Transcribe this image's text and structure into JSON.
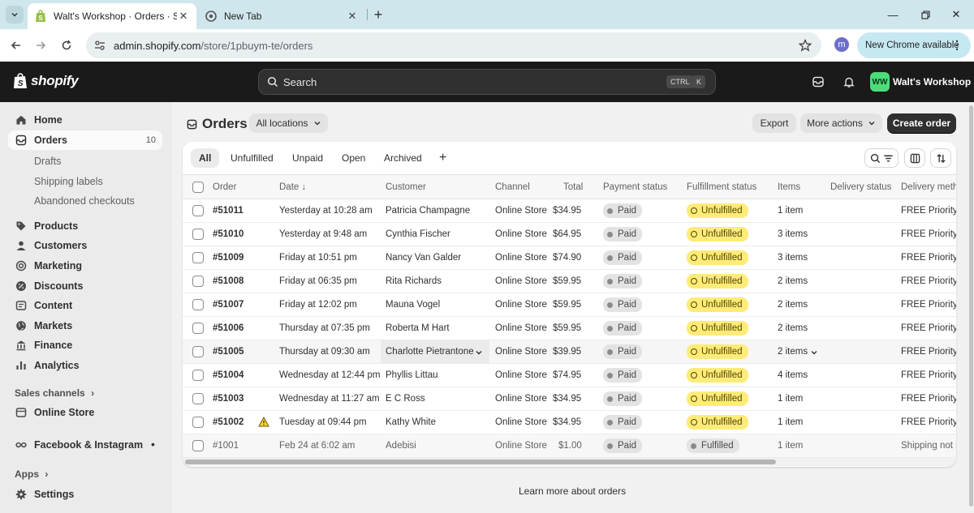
{
  "browser": {
    "tabs": [
      {
        "title": "Walt's Workshop · Orders · Shopify",
        "active": true
      },
      {
        "title": "New Tab",
        "active": false
      }
    ],
    "url_host": "admin.shopify.com",
    "url_path": "/store/1pbuym-te/orders",
    "profile_initial": "m",
    "update_label": "New Chrome available"
  },
  "topbar": {
    "logo_text": "shopify",
    "search_placeholder": "Search",
    "shortcut_ctrl": "CTRL",
    "shortcut_key": "K",
    "store_initials": "WW",
    "store_name": "Walt's Workshop",
    "colors": {
      "store_badge": "#4ddc7a"
    }
  },
  "sidebar": {
    "home": "Home",
    "orders": "Orders",
    "orders_count": "10",
    "orders_sub": [
      "Drafts",
      "Shipping labels",
      "Abandoned checkouts"
    ],
    "items": [
      "Products",
      "Customers",
      "Marketing",
      "Discounts",
      "Content",
      "Markets",
      "Finance",
      "Analytics"
    ],
    "sales_channels_label": "Sales channels",
    "online_store": "Online Store",
    "facebook": "Facebook & Instagram",
    "apps_label": "Apps",
    "settings": "Settings"
  },
  "page": {
    "title": "Orders",
    "location_select": "All locations",
    "export_label": "Export",
    "more_actions_label": "More actions",
    "create_order_label": "Create order",
    "learn_more": "Learn more about orders"
  },
  "filters": [
    "All",
    "Unfulfilled",
    "Unpaid",
    "Open",
    "Archived"
  ],
  "table": {
    "columns": [
      "Order",
      "Date",
      "Customer",
      "Channel",
      "Total",
      "Payment status",
      "Fulfillment status",
      "Items",
      "Delivery status",
      "Delivery method"
    ],
    "date_sort_arrow": "↓",
    "rows": [
      {
        "order": "#51011",
        "date": "Yesterday at 10:28 am",
        "customer": "Patricia Champagne",
        "channel": "Online Store",
        "total": "$34.95",
        "payment": "Paid",
        "fulfillment": "Unfulfilled",
        "items": "1 item",
        "delivery_method": "FREE Priority Ship"
      },
      {
        "order": "#51010",
        "date": "Yesterday at 9:48 am",
        "customer": "Cynthia Fischer",
        "channel": "Online Store",
        "total": "$64.95",
        "payment": "Paid",
        "fulfillment": "Unfulfilled",
        "items": "3 items",
        "delivery_method": "FREE Priority Ship"
      },
      {
        "order": "#51009",
        "date": "Friday at 10:51 pm",
        "customer": "Nancy Van Galder",
        "channel": "Online Store",
        "total": "$74.90",
        "payment": "Paid",
        "fulfillment": "Unfulfilled",
        "items": "3 items",
        "delivery_method": "FREE Priority Ship"
      },
      {
        "order": "#51008",
        "date": "Friday at 06:35 pm",
        "customer": "Rita Richards",
        "channel": "Online Store",
        "total": "$59.95",
        "payment": "Paid",
        "fulfillment": "Unfulfilled",
        "items": "2 items",
        "delivery_method": "FREE Priority Ship"
      },
      {
        "order": "#51007",
        "date": "Friday at 12:02 pm",
        "customer": "Mauna Vogel",
        "channel": "Online Store",
        "total": "$59.95",
        "payment": "Paid",
        "fulfillment": "Unfulfilled",
        "items": "2 items",
        "delivery_method": "FREE Priority Ship"
      },
      {
        "order": "#51006",
        "date": "Thursday at 07:35 pm",
        "customer": "Roberta M Hart",
        "channel": "Online Store",
        "total": "$59.95",
        "payment": "Paid",
        "fulfillment": "Unfulfilled",
        "items": "2 items",
        "delivery_method": "FREE Priority Ship"
      },
      {
        "order": "#51005",
        "date": "Thursday at 09:30 am",
        "customer": "Charlotte Pietrantone",
        "channel": "Online Store",
        "total": "$39.95",
        "payment": "Paid",
        "fulfillment": "Unfulfilled",
        "items": "2 items",
        "delivery_method": "FREE Priority Ship"
      },
      {
        "order": "#51004",
        "date": "Wednesday at 12:44 pm",
        "customer": "Phyllis Littau",
        "channel": "Online Store",
        "total": "$74.95",
        "payment": "Paid",
        "fulfillment": "Unfulfilled",
        "items": "4 items",
        "delivery_method": "FREE Priority Ship"
      },
      {
        "order": "#51003",
        "date": "Wednesday at 11:27 am",
        "customer": "E C Ross",
        "channel": "Online Store",
        "total": "$34.95",
        "payment": "Paid",
        "fulfillment": "Unfulfilled",
        "items": "1 item",
        "delivery_method": "FREE Priority Ship"
      },
      {
        "order": "#51002",
        "date": "Tuesday at 09:44 pm",
        "customer": "Kathy White",
        "channel": "Online Store",
        "total": "$34.95",
        "payment": "Paid",
        "fulfillment": "Unfulfilled",
        "items": "1 item",
        "delivery_method": "FREE Priority Ship"
      },
      {
        "order": "#1001",
        "date": "Feb 24 at 6:02 am",
        "customer": "Adebisi",
        "channel": "Online Store",
        "total": "$1.00",
        "payment": "Paid",
        "fulfillment": "Fulfilled",
        "items": "1 item",
        "delivery_method": "Shipping not requ"
      }
    ],
    "colors": {
      "unfulfilled": "#ffeb78",
      "paid": "#e3e3e3"
    }
  }
}
